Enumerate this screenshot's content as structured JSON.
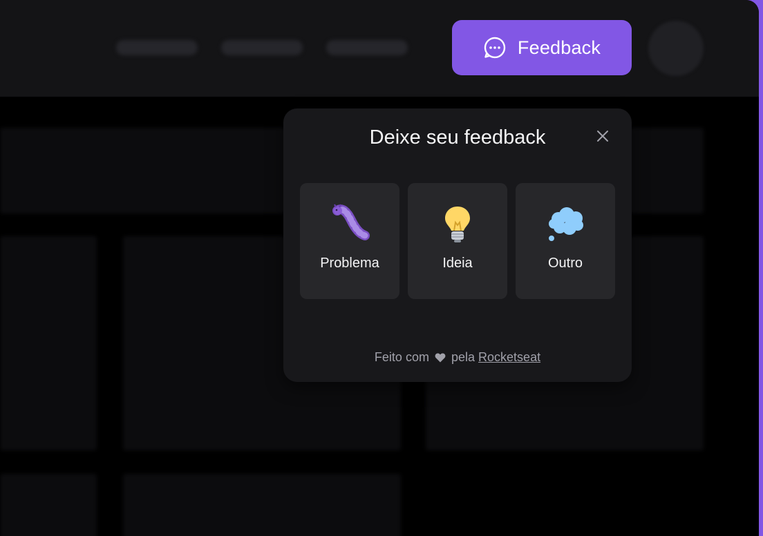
{
  "colors": {
    "brand": "#8257e5",
    "widget_bg": "#18181b",
    "option_bg": "#27272a",
    "text_primary": "#f4f4f5",
    "text_muted": "#a1a1aa"
  },
  "header": {
    "feedback_button": {
      "label": "Feedback",
      "icon": "chat-dots-icon"
    }
  },
  "widget": {
    "title": "Deixe seu feedback",
    "close_icon": "close-icon",
    "options": [
      {
        "label": "Problema",
        "icon": "bug-caterpillar-icon"
      },
      {
        "label": "Ideia",
        "icon": "lightbulb-icon"
      },
      {
        "label": "Outro",
        "icon": "thought-balloon-icon"
      }
    ],
    "footer": {
      "prefix": "Feito com",
      "heart_icon": "heart-icon",
      "middle": "pela",
      "link": "Rocketseat"
    }
  }
}
